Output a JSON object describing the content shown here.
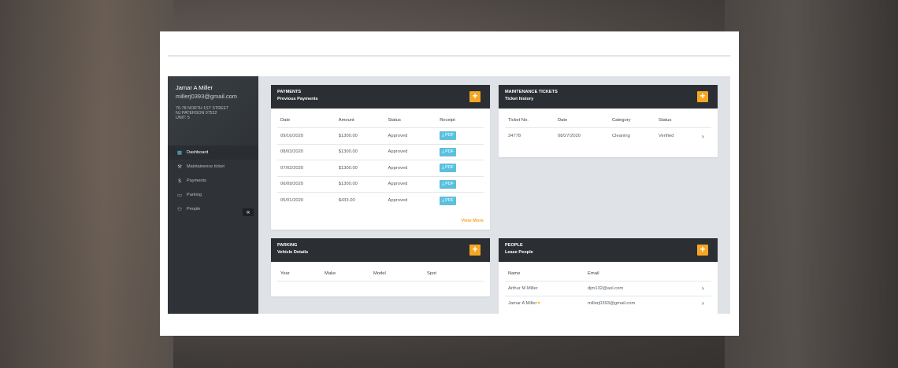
{
  "user": {
    "name": "Jamar A Miller",
    "email": "millerj0393@gmail.com",
    "address_line1": "76-78 NORTH 1ST STREET",
    "address_line2": "NJ PATERSON 07522",
    "unit": "UNIT: 5"
  },
  "sidebar": {
    "items": [
      {
        "label": "Dashboard",
        "icon": "grid-icon"
      },
      {
        "label": "Maintainence ticket",
        "icon": "tools-icon"
      },
      {
        "label": "Payments",
        "icon": "dollar-icon"
      },
      {
        "label": "Parking",
        "icon": "car-icon"
      },
      {
        "label": "People",
        "icon": "people-icon"
      }
    ],
    "collapse_label": "«"
  },
  "payments": {
    "title": "PAYMENTS",
    "subtitle": "Previous Payments",
    "add_label": "+",
    "columns": [
      "Date",
      "Amount",
      "Status",
      "Receipt"
    ],
    "rows": [
      {
        "date": "09/16/2020",
        "amount": "$1300.00",
        "status": "Approved",
        "receipt": "PDF"
      },
      {
        "date": "08/03/2020",
        "amount": "$1300.00",
        "status": "Approved",
        "receipt": "PDF"
      },
      {
        "date": "07/02/2020",
        "amount": "$1300.00",
        "status": "Approved",
        "receipt": "PDF"
      },
      {
        "date": "06/09/2020",
        "amount": "$1300.00",
        "status": "Approved",
        "receipt": "PDF"
      },
      {
        "date": "05/01/2020",
        "amount": "$433.00",
        "status": "Approved",
        "receipt": "PDF"
      }
    ],
    "view_more": "View More"
  },
  "maintenance": {
    "title": "MAINTENANCE TICKETS",
    "subtitle": "Ticket history",
    "add_label": "+",
    "columns": [
      "Ticket No.",
      "Date",
      "Category",
      "Status"
    ],
    "rows": [
      {
        "ticket": "34778",
        "date": "08/27/2020",
        "category": "Cleaning",
        "status": "Verified"
      }
    ]
  },
  "parking": {
    "title": "PARKING",
    "subtitle": "Vehicle Details",
    "add_label": "+",
    "columns": [
      "Year",
      "Make",
      "Model",
      "Spot"
    ]
  },
  "people": {
    "title": "PEOPLE",
    "subtitle": "Lease People",
    "add_label": "+",
    "columns": [
      "Name",
      "Email"
    ],
    "rows": [
      {
        "name": "Arthur M Miller",
        "email": "djm132@aol.com",
        "star": ""
      },
      {
        "name": "Jamar A Miller",
        "email": "millerj0393@gmail.com",
        "star": "★"
      }
    ]
  },
  "colors": {
    "accent": "#f5a623",
    "pdf": "#5bc0de",
    "sidebar": "#2f3337",
    "header": "#2b2f33"
  }
}
